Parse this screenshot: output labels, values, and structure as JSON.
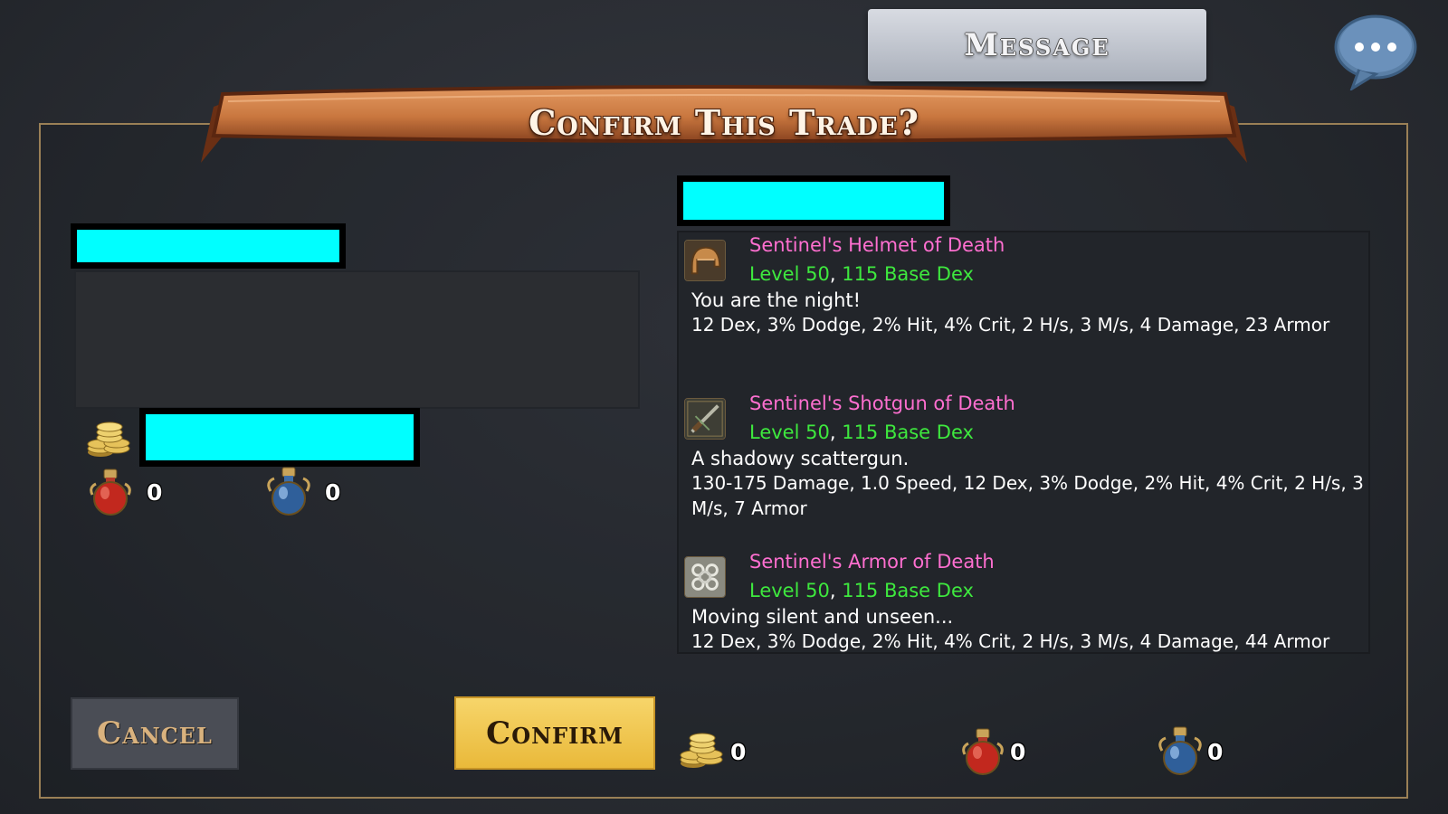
{
  "header": {
    "message_label": "Message",
    "title": "Confirm This Trade?"
  },
  "left_offer": {
    "gold": "",
    "red_potions": "0",
    "blue_potions": "0"
  },
  "right_offer": {
    "items": [
      {
        "name": "Sentinel's Helmet of Death",
        "level": "Level 50",
        "base": "115 Base Dex",
        "description": "You are the night!",
        "stats": "12 Dex, 3% Dodge, 2% Hit, 4% Crit, 2 H/s, 3 M/s, 4 Damage, 23 Armor",
        "icon": "helmet-icon"
      },
      {
        "name": "Sentinel's Shotgun of Death",
        "level": "Level 50",
        "base": "115 Base Dex",
        "description": "A shadowy scattergun.",
        "stats": "130-175 Damage, 1.0 Speed, 12 Dex, 3% Dodge, 2% Hit, 4% Crit, 2 H/s, 3 M/s, 7 Armor",
        "icon": "shotgun-icon"
      },
      {
        "name": "Sentinel's Armor of Death",
        "level": "Level 50",
        "base": "115 Base Dex",
        "description": "Moving silent and unseen...",
        "stats": "12 Dex, 3% Dodge, 2% Hit, 4% Crit, 2 H/s, 3 M/s, 4 Damage, 44 Armor",
        "icon": "armor-icon"
      }
    ],
    "gold": "0",
    "red_potions": "0",
    "blue_potions": "0"
  },
  "buttons": {
    "cancel_label": "Cancel",
    "confirm_label": "Confirm"
  },
  "colors": {
    "item_name": "#ff6fd0",
    "item_level": "#3ee83e",
    "confirm_bg": "#f0c64e",
    "redaction": "#00ffff"
  }
}
